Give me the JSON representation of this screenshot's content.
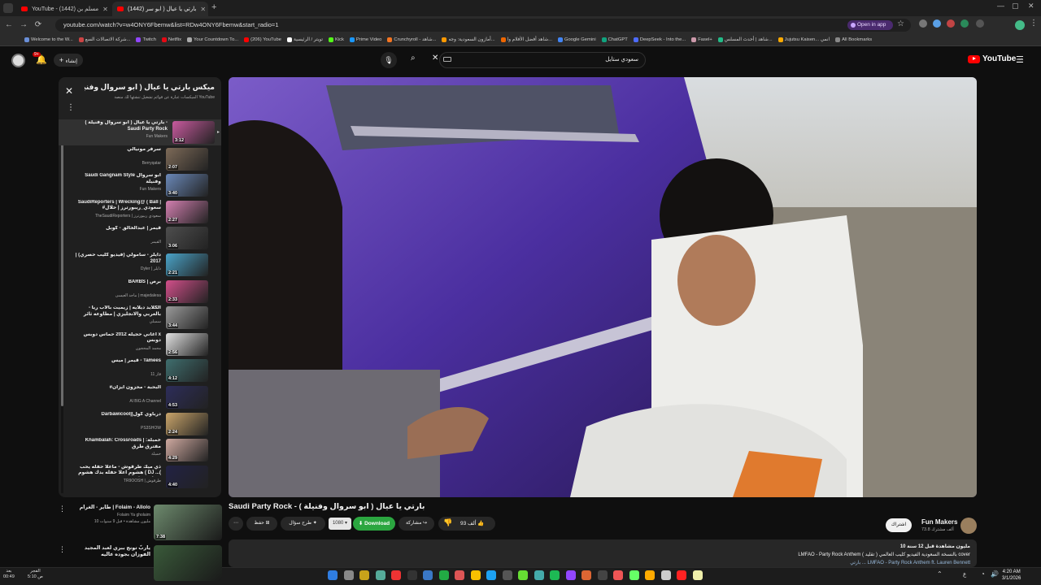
{
  "browser": {
    "tabs": [
      {
        "title": "YouTube - مسلم بن (1442)",
        "active": false
      },
      {
        "title": "(1442) بارتي يا عيال ( ابو سر",
        "active": true
      }
    ],
    "url": "youtube.com/watch?v=w4ONY6Fbemw&list=RDw4ONY6Fbemw&start_radio=1",
    "open_in_app": "Open in app",
    "bookmarks": [
      "Welcome to the W...",
      "شركة الاتصالات السع...",
      "Twitch",
      "Netflix",
      "Your Countdown To...",
      "(206) YouTube",
      "تويتر / الرئيسية",
      "Kick",
      "Prime Video",
      "Crunchyroll - شاهد...",
      "أمازون السعودية: وجه...",
      "شاهد أفضل الأفلام وا...",
      "Google Gemini",
      "ChatGPT",
      "DeepSeek - Into the...",
      "Fasel+",
      "شاهد | أحدث المسلس...",
      "Jujutsu Kaisen... انمي",
      "All Bookmarks"
    ]
  },
  "youtube": {
    "logo": "YouTube",
    "logo_region": "SA",
    "search_query": "سعودي ستايل",
    "create_label": "إنشاء",
    "notif_count": "9+"
  },
  "playlist": {
    "title": "ميكس بارتي يا عيال ( ابو سروال وفنيلة...",
    "subtitle": "الميكسات عبارة عن قوائم تشغيل تنشئها لك منصة YouTube",
    "items": [
      {
        "title": "بارتي يا عيال ( ابو سروال وفنيلة ) - Saudi Party Rock",
        "channel": "Fun Makers",
        "duration": "3:12",
        "color": "#c85a9e"
      },
      {
        "title": "سرفر مونيالي",
        "channel": "Berryqatar",
        "duration": "2:07",
        "color": "#7d6a58"
      },
      {
        "title": "Saudi Gangnam Style ابو سروال وفنيلة",
        "channel": "Fun Makers",
        "duration": "3:40",
        "color": "#6a88b8"
      },
      {
        "title": "SaudiReporters | Wrecking@ ( Ball | #سعودي_ريبورترز | حلال",
        "channel": "TheSaudiReporters | سعودي ريبورترز",
        "duration": "2:27",
        "color": "#d37fb0"
      },
      {
        "title": "قيمر | عبدالخالق - كوبل",
        "channel": "القيمر",
        "duration": "3:06",
        "color": "#4e4e4e"
      },
      {
        "title": "دايلر - سامولي (فيديو كليب حصري) | 2017",
        "channel": "Dyler | دايلر",
        "duration": "2:21",
        "color": "#4aa3c8"
      },
      {
        "title": "BARBS | برص",
        "channel": "ماجد العيسى | majedalesa",
        "duration": "2:33",
        "color": "#d24f8a"
      },
      {
        "title": "الكلايد ديلايه | زيميت بالاب ريا - بالعربي والانجليزي | مطاوعه ثائر تش...",
        "channel": "سمبلي",
        "duration": "3:44",
        "color": "#9a9a9a"
      },
      {
        "title": "اغاني حجيله 2012 حماس دوبس x دوبس",
        "channel": "محمد المحجون",
        "duration": "2:56",
        "color": "#e0e0e0"
      },
      {
        "title": "قيمر | ميس - Tamees",
        "channel": "قاز 11",
        "duration": "4:12",
        "color": "#3f6e6e"
      },
      {
        "title": "#البحبة - محزون ايزان",
        "channel": "Al BIG A Channel",
        "duration": "4:53",
        "color": "#2d2d5a"
      },
      {
        "title": "Darbawicool||دربأوي كول",
        "channel": "PS3SHOW",
        "duration": "2:24",
        "color": "#c9a46a"
      },
      {
        "title": "Khambalah: Crossroads | خمبلة: مفترق طرق",
        "channel": "خمبلة",
        "duration": "4:29",
        "color": "#cfa9a0"
      },
      {
        "title": "ذي ميك طرقوش - ماعلا حفله يحب هشوم اعلا حفله بدك هشوم ( DJ ...( دوبلة ريمكس",
        "channel": "TR9OOSH | طرقوش",
        "duration": "4:40",
        "color": "#222244"
      }
    ]
  },
  "video": {
    "title": "بارتي يا عيال ( ابو سروال وفنيلة ) - Saudi Party Rock",
    "channel": "Fun Makers",
    "subscribers": "73.8 ألف مشترك",
    "subscribe_label": "اشتراك",
    "likes": "93 ألف",
    "share_label": "مشاركة",
    "remix_label": "طرح سؤال",
    "save_label": "حفظ",
    "download_label": "Download",
    "quality": "1080",
    "desc_views": "10 مليون مشاهدة  قبل 12 سنة",
    "desc_line1": "LMFAO - Party Rock Anthem بالنسخة السعودية الفيديو كليب العالمي ( تقليد ) cover",
    "desc_line2": "بارتي ... LMFAO - Party Rock Anthem ft. Lauren Bennett"
  },
  "recommendations": [
    {
      "title": "طاير - الغرام | Folaim - Allolo",
      "channel": "Folaim Ya gholaim",
      "views": "10 مليون مشاهدة • قبل 9 سنوات",
      "duration": "7:38",
      "color": "#6d8a6d"
    },
    {
      "title": "ياربّ تونج ببري لعبد المجيد الفوزان بجوده عاليه",
      "channel": "",
      "views": "",
      "duration": "",
      "color": "#3a5a3a"
    }
  ],
  "system": {
    "time": "4:20 AM",
    "date": "3/1/2026",
    "weather_top": "بعد",
    "weather_bottom": "00:49",
    "prayer_top": "الفجر",
    "prayer_bottom": "5:10 ص",
    "lang": "ع"
  }
}
